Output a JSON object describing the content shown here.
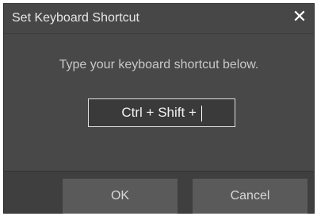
{
  "dialog": {
    "title": "Set Keyboard Shortcut",
    "close_label": "✕",
    "prompt": "Type your keyboard shortcut below.",
    "shortcut_value": "Ctrl + Shift + ",
    "ok_label": "OK",
    "cancel_label": "Cancel"
  },
  "colors": {
    "title_bar": "#474747",
    "body": "#484848",
    "footer": "#3f3f3f",
    "button": "#5a5a5a",
    "field_border": "#e0e0e0"
  }
}
